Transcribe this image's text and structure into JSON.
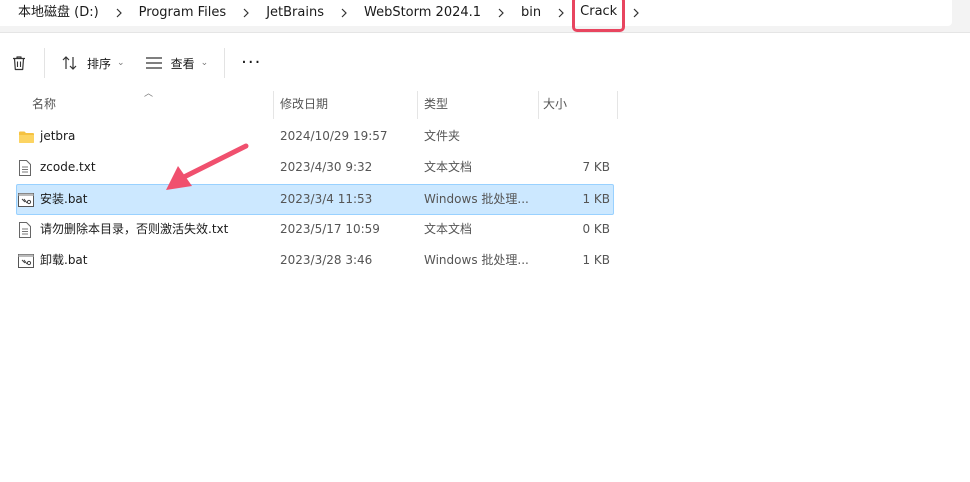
{
  "breadcrumb": {
    "items": [
      "本地磁盘 (D:)",
      "Program Files",
      "JetBrains",
      "WebStorm 2024.1",
      "bin",
      "Crack"
    ],
    "current": "Crack"
  },
  "toolbar": {
    "delete_icon": "trash-icon",
    "sort_label": "排序",
    "view_label": "查看",
    "more_icon": "more-icon"
  },
  "columns": {
    "name": "名称",
    "date": "修改日期",
    "type": "类型",
    "size": "大小"
  },
  "files": [
    {
      "name": "jetbra",
      "date": "2024/10/29 19:57",
      "type": "文件夹",
      "size": "",
      "icon": "folder-icon"
    },
    {
      "name": "zcode.txt",
      "date": "2023/4/30 9:32",
      "type": "文本文档",
      "size": "7 KB",
      "icon": "text-file-icon"
    },
    {
      "name": "安装.bat",
      "date": "2023/3/4 11:53",
      "type": "Windows 批处理...",
      "size": "1 KB",
      "icon": "batch-file-icon"
    },
    {
      "name": "请勿删除本目录，否则激活失效.txt",
      "date": "2023/5/17 10:59",
      "type": "文本文档",
      "size": "0 KB",
      "icon": "text-file-icon"
    },
    {
      "name": "卸载.bat",
      "date": "2023/3/28 3:46",
      "type": "Windows 批处理...",
      "size": "1 KB",
      "icon": "batch-file-icon"
    }
  ],
  "selected_file": "安装.bat",
  "colors": {
    "highlight_outline": "#e8455f",
    "selection_bg": "#cce8ff",
    "arrow": "#f0506e"
  }
}
